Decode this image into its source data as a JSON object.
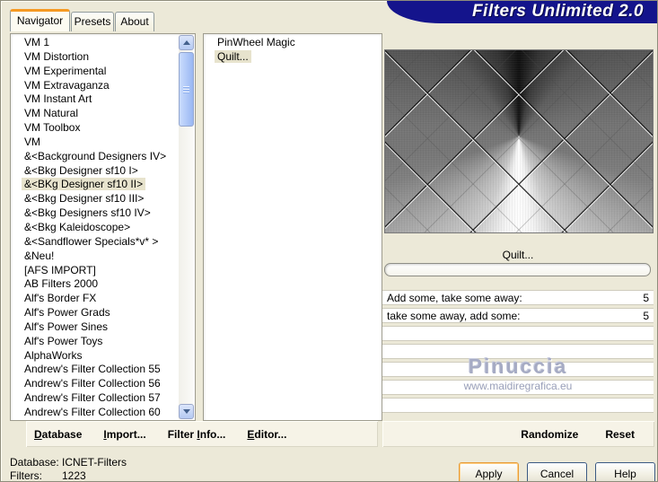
{
  "window": {
    "title": "Filters Unlimited 2.0"
  },
  "tabs": [
    {
      "label": "Navigator",
      "active": true
    },
    {
      "label": "Presets",
      "active": false
    },
    {
      "label": "About",
      "active": false
    }
  ],
  "category_list": {
    "selected_index": 10,
    "items": [
      "VM 1",
      "VM Distortion",
      "VM Experimental",
      "VM Extravaganza",
      "VM Instant Art",
      "VM Natural",
      "VM Toolbox",
      "VM",
      "&<Background Designers IV>",
      "&<Bkg Designer sf10 I>",
      "&<BKg Designer sf10 II>",
      "&<Bkg Designer sf10 III>",
      "&<Bkg Designers sf10 IV>",
      "&<Bkg Kaleidoscope>",
      "&<Sandflower Specials*v* >",
      "&Neu!",
      "[AFS IMPORT]",
      "AB Filters 2000",
      "Alf's Border FX",
      "Alf's Power Grads",
      "Alf's Power Sines",
      "Alf's Power Toys",
      "AlphaWorks",
      "Andrew's Filter Collection 55",
      "Andrew's Filter Collection 56",
      "Andrew's Filter Collection 57",
      "Andrew's Filter Collection 60"
    ]
  },
  "filter_list": {
    "selected_index": 1,
    "items": [
      "PinWheel Magic",
      "Quilt..."
    ]
  },
  "preview": {
    "filter_title": "Quilt..."
  },
  "parameters": {
    "rows": [
      {
        "label": "Add some, take some away:",
        "value": "5"
      },
      {
        "label": "take some away, add some:",
        "value": "5"
      },
      {
        "label": "",
        "value": ""
      },
      {
        "label": "",
        "value": ""
      },
      {
        "label": "",
        "value": ""
      },
      {
        "label": "",
        "value": ""
      },
      {
        "label": "",
        "value": ""
      }
    ]
  },
  "watermark": {
    "name": "Pinuccia",
    "url": "www.maidiregrafica.eu"
  },
  "toolbar_left": [
    {
      "label": "Database",
      "hotkey_index": 0
    },
    {
      "label": "Import...",
      "hotkey_index": 0
    },
    {
      "label": "Filter Info...",
      "hotkey_index": 7
    },
    {
      "label": "Editor...",
      "hotkey_index": 0
    }
  ],
  "toolbar_right": [
    {
      "label": "Randomize"
    },
    {
      "label": "Reset"
    }
  ],
  "status": [
    {
      "label": "Database:",
      "value": "ICNET-Filters"
    },
    {
      "label": "Filters:",
      "value": "1223"
    }
  ],
  "action_buttons": [
    {
      "label": "Apply"
    },
    {
      "label": "Cancel"
    },
    {
      "label": "Help"
    }
  ],
  "colors": {
    "banner": "#14148C",
    "dialog_bg": "#ECE9D8",
    "tab_accent": "#F59A23",
    "selection_bg": "#E7E3CD",
    "watermark": "#A6ABC4"
  }
}
